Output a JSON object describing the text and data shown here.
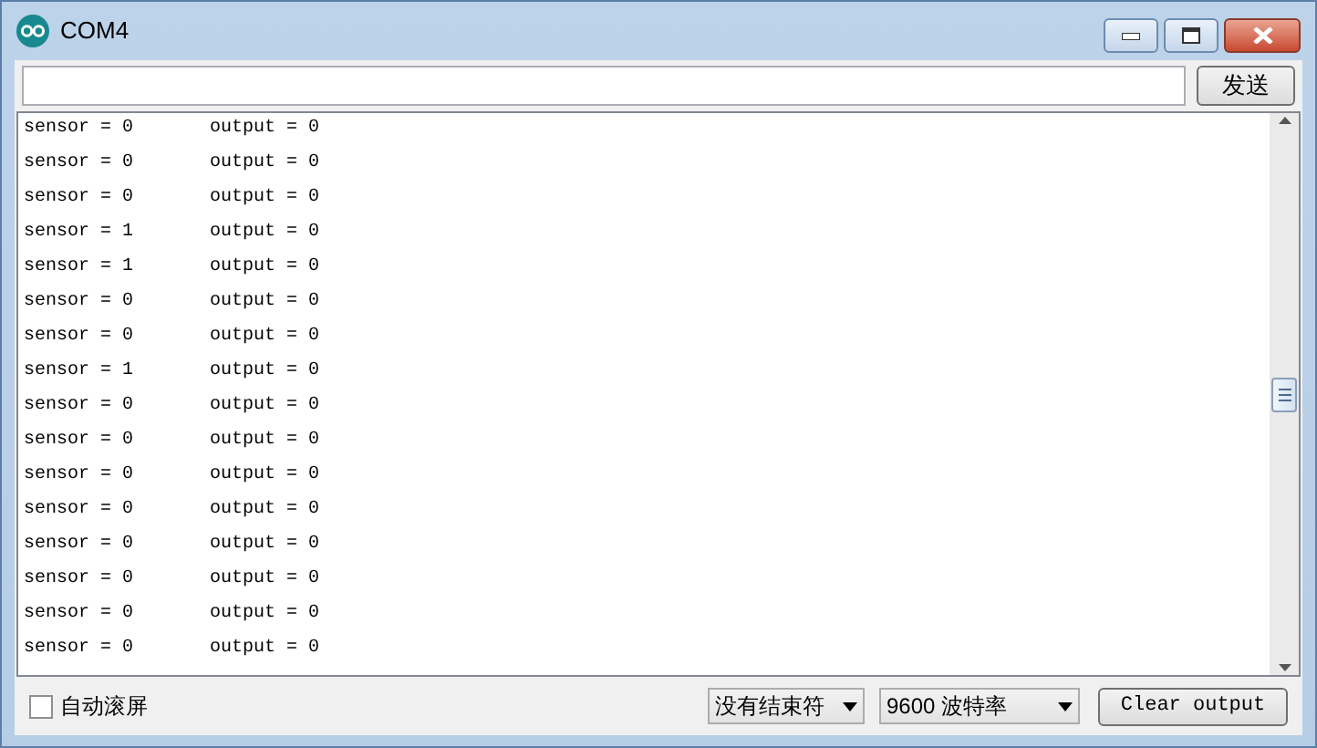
{
  "window": {
    "title": "COM4"
  },
  "send_button": "发送",
  "rows": [
    {
      "sensor": "sensor = 0",
      "output": "output = 0"
    },
    {
      "sensor": "sensor = 0",
      "output": "output = 0"
    },
    {
      "sensor": "sensor = 0",
      "output": "output = 0"
    },
    {
      "sensor": "sensor = 1",
      "output": "output = 0"
    },
    {
      "sensor": "sensor = 1",
      "output": "output = 0"
    },
    {
      "sensor": "sensor = 0",
      "output": "output = 0"
    },
    {
      "sensor": "sensor = 0",
      "output": "output = 0"
    },
    {
      "sensor": "sensor = 1",
      "output": "output = 0"
    },
    {
      "sensor": "sensor = 0",
      "output": "output = 0"
    },
    {
      "sensor": "sensor = 0",
      "output": "output = 0"
    },
    {
      "sensor": "sensor = 0",
      "output": "output = 0"
    },
    {
      "sensor": "sensor = 0",
      "output": "output = 0"
    },
    {
      "sensor": "sensor = 0",
      "output": "output = 0"
    },
    {
      "sensor": "sensor = 0",
      "output": "output = 0"
    },
    {
      "sensor": "sensor = 0",
      "output": "output = 0"
    },
    {
      "sensor": "sensor = 0",
      "output": "output = 0"
    }
  ],
  "autoscroll": {
    "label": "自动滚屏",
    "checked": false
  },
  "line_ending": "没有结束符",
  "baud_rate": "9600 波特率",
  "clear_button": "Clear output"
}
